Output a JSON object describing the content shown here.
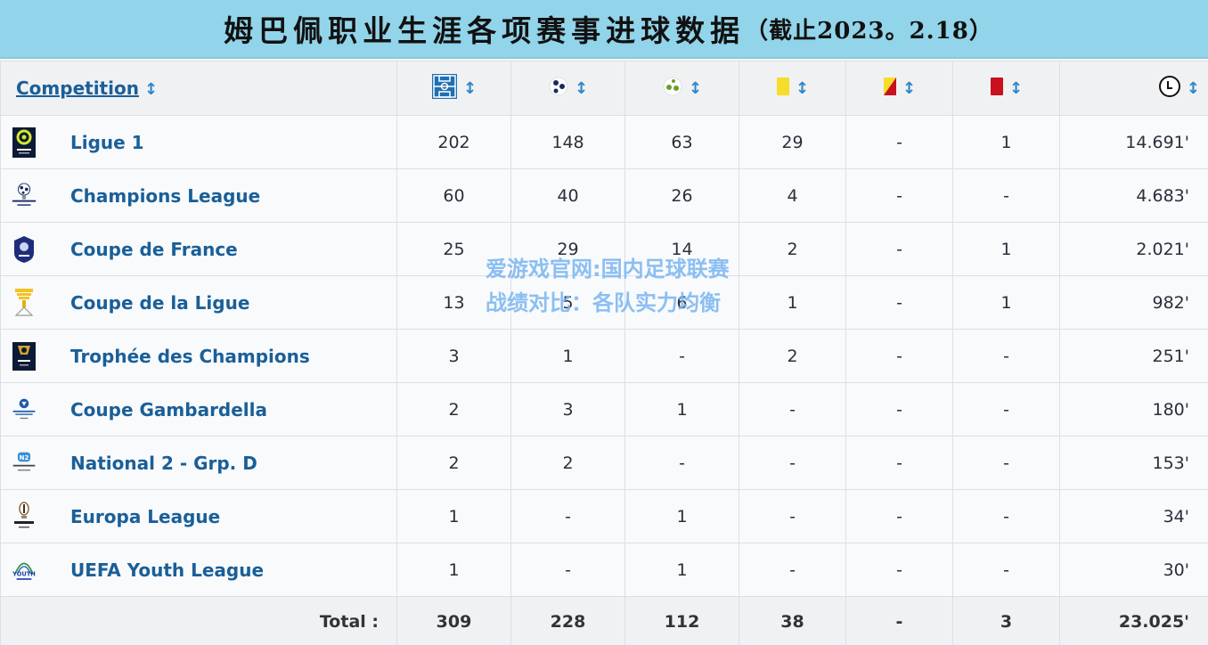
{
  "banner": {
    "title": "姆巴佩职业生涯各项赛事进球数据",
    "subtitle": "（截止2023。2.18）"
  },
  "table": {
    "headers": {
      "competition": "Competition",
      "columns": [
        {
          "icon": "pitch-appearances-icon",
          "sort_icon": "sort-icon"
        },
        {
          "icon": "ball-goals-icon",
          "sort_icon": "sort-icon"
        },
        {
          "icon": "ball-assists-icon",
          "sort_icon": "sort-icon"
        },
        {
          "icon": "yellow-card-icon",
          "sort_icon": "sort-icon"
        },
        {
          "icon": "yellow-red-card-icon",
          "sort_icon": "sort-icon"
        },
        {
          "icon": "red-card-icon",
          "sort_icon": "sort-icon"
        },
        {
          "icon": "clock-minutes-icon",
          "sort_icon": "sort-icon"
        }
      ]
    },
    "rows": [
      {
        "competition": "Ligue 1",
        "logo": "ligue1-logo",
        "apps": "202",
        "goals": "148",
        "assists": "63",
        "yellow": "29",
        "yellow_red": "-",
        "red": "1",
        "minutes": "14.691'"
      },
      {
        "competition": "Champions League",
        "logo": "champions-league-logo",
        "apps": "60",
        "goals": "40",
        "assists": "26",
        "yellow": "4",
        "yellow_red": "-",
        "red": "-",
        "minutes": "4.683'"
      },
      {
        "competition": "Coupe de France",
        "logo": "coupe-de-france-logo",
        "apps": "25",
        "goals": "29",
        "assists": "14",
        "yellow": "2",
        "yellow_red": "-",
        "red": "1",
        "minutes": "2.021'"
      },
      {
        "competition": "Coupe de la Ligue",
        "logo": "coupe-de-la-ligue-logo",
        "apps": "13",
        "goals": "5",
        "assists": "6",
        "yellow": "1",
        "yellow_red": "-",
        "red": "1",
        "minutes": "982'"
      },
      {
        "competition": "Trophée des Champions",
        "logo": "trophee-des-champions-logo",
        "apps": "3",
        "goals": "1",
        "assists": "-",
        "yellow": "2",
        "yellow_red": "-",
        "red": "-",
        "minutes": "251'"
      },
      {
        "competition": "Coupe Gambardella",
        "logo": "coupe-gambardella-logo",
        "apps": "2",
        "goals": "3",
        "assists": "1",
        "yellow": "-",
        "yellow_red": "-",
        "red": "-",
        "minutes": "180'"
      },
      {
        "competition": "National 2 - Grp. D",
        "logo": "national-2-logo",
        "apps": "2",
        "goals": "2",
        "assists": "-",
        "yellow": "-",
        "yellow_red": "-",
        "red": "-",
        "minutes": "153'"
      },
      {
        "competition": "Europa League",
        "logo": "europa-league-logo",
        "apps": "1",
        "goals": "-",
        "assists": "1",
        "yellow": "-",
        "yellow_red": "-",
        "red": "-",
        "minutes": "34'"
      },
      {
        "competition": "UEFA Youth League",
        "logo": "uefa-youth-league-logo",
        "apps": "1",
        "goals": "-",
        "assists": "1",
        "yellow": "-",
        "yellow_red": "-",
        "red": "-",
        "minutes": "30'"
      }
    ],
    "totals": {
      "label": "Total :",
      "apps": "309",
      "goals": "228",
      "assists": "112",
      "yellow": "38",
      "yellow_red": "-",
      "red": "3",
      "minutes": "23.025'"
    }
  },
  "watermark": {
    "text": "爱游戏官网:国内足球联赛战绩对比：各队实力均衡"
  },
  "colors": {
    "banner_bg": "#92d4ea",
    "link_blue": "#1a5f98",
    "sort_blue": "#2f86c5",
    "yellow_card": "#f7dc2a",
    "red_card": "#c8101e",
    "watermark": "#78b4f0"
  }
}
